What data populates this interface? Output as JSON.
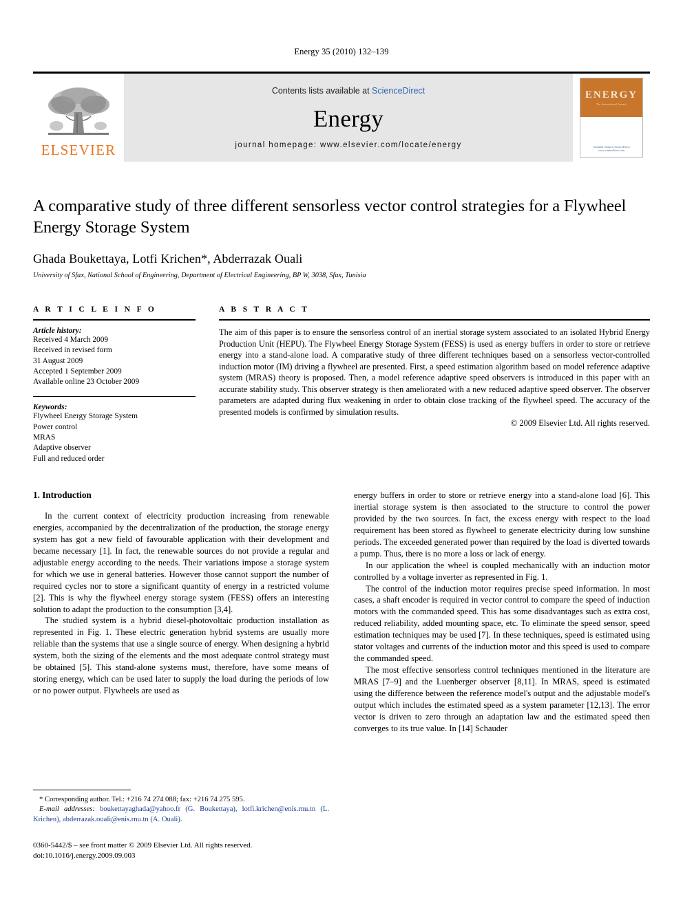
{
  "running_head": "Energy 35 (2010) 132–139",
  "masthead": {
    "logo_word": "ELSEVIER",
    "contents_prefix": "Contents lists available at ",
    "contents_link": "ScienceDirect",
    "journal_name": "Energy",
    "homepage": "journal homepage: www.elsevier.com/locate/energy",
    "cover": {
      "title": "ENERGY",
      "subtitle": "The International Journal",
      "footer": "Available online at\nScienceDirect\nwww.sciencedirect.com"
    },
    "colors": {
      "link_blue": "#2b64b4",
      "elsevier_orange": "#E87722",
      "cover_orange": "#C8762C",
      "masthead_grey": "#e6e6e6"
    }
  },
  "title": "A comparative study of three different sensorless vector control strategies for a Flywheel Energy Storage System",
  "authors": "Ghada Boukettaya, Lotfi Krichen*, Abderrazak Ouali",
  "affiliation": "University of Sfax, National School of Engineering, Department of Electrical Engineering, BP W, 3038, Sfax, Tunisia",
  "article_info": {
    "heading": "A R T I C L E   I N F O",
    "history_label": "Article history:",
    "history": [
      "Received 4 March 2009",
      "Received in revised form",
      "31 August 2009",
      "Accepted 1 September 2009",
      "Available online 23 October 2009"
    ],
    "keywords_label": "Keywords:",
    "keywords": [
      "Flywheel Energy Storage System",
      "Power control",
      "MRAS",
      "Adaptive observer",
      "Full and reduced order"
    ]
  },
  "abstract": {
    "heading": "A B S T R A C T",
    "text": "The aim of this paper is to ensure the sensorless control of an inertial storage system associated to an isolated Hybrid Energy Production Unit (HEPU). The Flywheel Energy Storage System (FESS) is used as energy buffers in order to store or retrieve energy into a stand-alone load. A comparative study of three different techniques based on a sensorless vector-controlled induction motor (IM) driving a flywheel are presented. First, a speed estimation algorithm based on model reference adaptive system (MRAS) theory is proposed. Then, a model reference adaptive speed observers is introduced in this paper with an accurate stability study. This observer strategy is then ameliorated with a new reduced adaptive speed observer. The observer parameters are adapted during flux weakening in order to obtain close tracking of the flywheel speed. The accuracy of the presented models is confirmed by simulation results.",
    "copyright": "© 2009 Elsevier Ltd. All rights reserved."
  },
  "body": {
    "section_title": "1. Introduction",
    "left_paragraphs": [
      "In the current context of electricity production increasing from renewable energies, accompanied by the decentralization of the production, the storage energy system has got a new field of favourable application with their development and became necessary [1]. In fact, the renewable sources do not provide a regular and adjustable energy according to the needs. Their variations impose a storage system for which we use in general batteries. However those cannot support the number of required cycles nor to store a significant quantity of energy in a restricted volume [2]. This is why the flywheel energy storage system (FESS) offers an interesting solution to adapt the production to the consumption [3,4].",
      "The studied system is a hybrid diesel-photovoltaic production installation as represented in Fig. 1. These electric generation hybrid systems are usually more reliable than the systems that use a single source of energy. When designing a hybrid system, both the sizing of the elements and the most adequate control strategy must be obtained [5]. This stand-alone systems must, therefore, have some means of storing energy, which can be used later to supply the load during the periods of low or no power output. Flywheels are used as"
    ],
    "right_paragraphs": [
      "energy buffers in order to store or retrieve energy into a stand-alone load [6]. This inertial storage system is then associated to the structure to control the power provided by the two sources. In fact, the excess energy with respect to the load requirement has been stored as flywheel to generate electricity during low sunshine periods. The exceeded generated power than required by the load is diverted towards a pump. Thus, there is no more a loss or lack of energy.",
      "In our application the wheel is coupled mechanically with an induction motor controlled by a voltage inverter as represented in Fig. 1.",
      "The control of the induction motor requires precise speed information. In most cases, a shaft encoder is required in vector control to compare the speed of induction motors with the commanded speed. This has some disadvantages such as extra cost, reduced reliability, added mounting space, etc. To eliminate the speed sensor, speed estimation techniques may be used [7]. In these techniques, speed is estimated using stator voltages and currents of the induction motor and this speed is used to compare the commanded speed.",
      "The most effective sensorless control techniques mentioned in the literature are MRAS [7–9] and the Luenberger observer [8,11]. In MRAS, speed is estimated using the difference between the reference model's output and the adjustable model's output which includes the estimated speed as a system parameter [12,13]. The error vector is driven to zero through an adaptation law and the estimated speed then converges to its true value. In [14] Schauder"
    ]
  },
  "footnotes": {
    "corresponding": "* Corresponding author. Tel.: +216 74 274 088; fax: +216 74 275 595.",
    "email_label": "E-mail addresses:",
    "emails": "boukettayaghada@yahoo.fr (G. Boukettaya), lotfi.krichen@enis.rnu.tn (L. Krichen), abderrazak.ouali@enis.rnu.tn (A. Ouali).",
    "issn_line": "0360-5442/$ – see front matter © 2009 Elsevier Ltd. All rights reserved.",
    "doi_line": "doi:10.1016/j.energy.2009.09.003"
  }
}
